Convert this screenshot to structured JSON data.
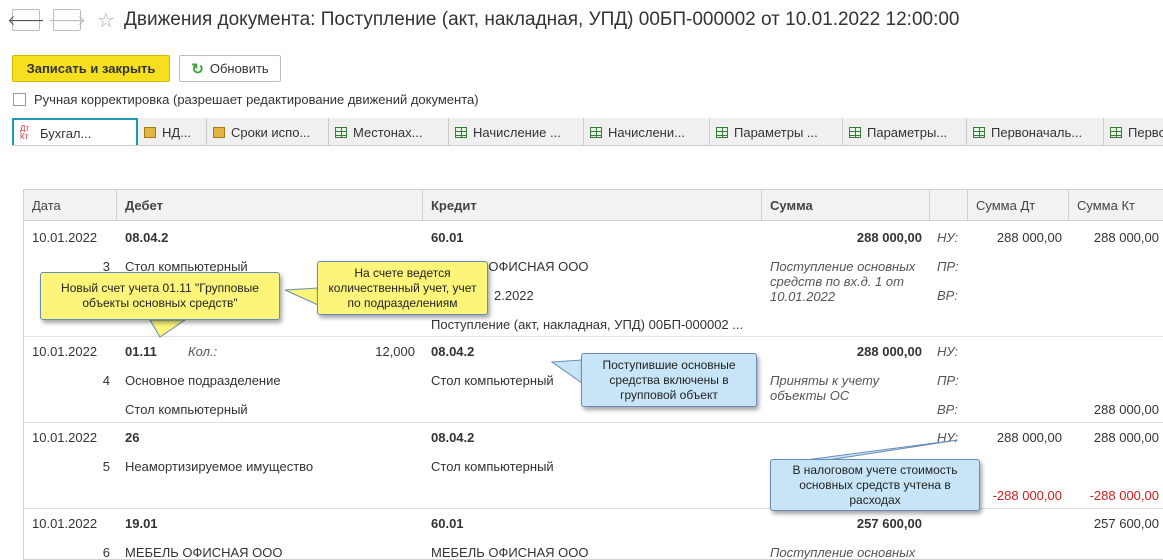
{
  "nav": {
    "back_icon": "arrow-left-icon",
    "forward_icon": "arrow-right-icon"
  },
  "window_title": "Движения документа: Поступление (акт, накладная, УПД) 00БП-000002 от 10.01.2022 12:00:00",
  "toolbar": {
    "save_close_label": "Записать и закрыть",
    "refresh_label": "Обновить"
  },
  "manual_correction_label": "Ручная корректировка (разрешает редактирование движений документа)",
  "tabs": [
    {
      "label": "Бухгал...",
      "icon": "dt-kt-icon"
    },
    {
      "label": "НД...",
      "icon": "register-icon"
    },
    {
      "label": "Сроки испо...",
      "icon": "register-icon"
    },
    {
      "label": "Местонах...",
      "icon": "table-icon"
    },
    {
      "label": "Начисление ...",
      "icon": "table-icon"
    },
    {
      "label": "Начислени...",
      "icon": "table-icon"
    },
    {
      "label": "Параметры ...",
      "icon": "table-icon"
    },
    {
      "label": "Параметры...",
      "icon": "table-icon"
    },
    {
      "label": "Первоначаль...",
      "icon": "table-icon"
    },
    {
      "label": "Первонача",
      "icon": "table-icon"
    }
  ],
  "grid": {
    "headers": {
      "date": "Дата",
      "debit": "Дебет",
      "credit": "Кредит",
      "sum": "Сумма",
      "sum_dt": "Сумма Дт",
      "sum_kt": "Сумма Кт"
    },
    "rows": [
      {
        "date": "10.01.2022",
        "num": "3",
        "debit_account": "08.04.2",
        "debit_sub1": "Стол компьютерный",
        "credit_account": "60.01",
        "credit_sub1": "МЕБЕЛЬ ОФИСНАЯ ООО",
        "credit_sub2": "2.2022",
        "credit_sub3": "Поступление (акт, накладная, УПД) 00БП-000002 ...",
        "sum": "288 000,00",
        "content": "Поступление основных средств по вх.д. 1 от 10.01.2022",
        "nu": "НУ:",
        "pr": "ПР:",
        "vr": "ВР:",
        "nu_dt": "288 000,00",
        "nu_kt": "288 000,00"
      },
      {
        "date": "10.01.2022",
        "num": "4",
        "debit_account": "01.11",
        "qty_label": "Кол.:",
        "qty": "12,000",
        "debit_sub1": "Основное подразделение",
        "debit_sub2": "Стол компьютерный",
        "credit_account": "08.04.2",
        "credit_sub1": "Стол компьютерный",
        "sum": "288 000,00",
        "content": "Приняты к учету объекты ОС",
        "nu": "НУ:",
        "pr": "ПР:",
        "vr": "ВР:",
        "vr_kt": "288 000,00"
      },
      {
        "date": "10.01.2022",
        "num": "5",
        "debit_account": "26",
        "debit_sub1": "Неамортизируемое имущество",
        "credit_account": "08.04.2",
        "credit_sub1": "Стол компьютерный",
        "nu": "НУ:",
        "nu_dt": "288 000,00",
        "nu_kt": "288 000,00",
        "vr_dt": "-288 000,00",
        "vr_kt": "-288 000,00"
      },
      {
        "date": "10.01.2022",
        "num": "6",
        "debit_account": "19.01",
        "debit_sub1": "МЕБЕЛЬ ОФИСНАЯ ООО",
        "credit_account": "60.01",
        "credit_sub1": "МЕБЕЛЬ ОФИСНАЯ ООО",
        "sum": "257 600,00",
        "content": "Поступление основных",
        "nu_kt": "257 600,00"
      }
    ]
  },
  "callouts": {
    "new_account": "Новый счет учета 01.11 \"Групповые объекты основных средств\"",
    "quantity": "На счете ведется количественный учет, учет по подразделениям",
    "group_object": "Поступившие основные средства включены в групповой объект",
    "tax": "В налоговом учете стоимость основных средств учтена в расходах"
  },
  "colors": {
    "accent": "#1c9bb5",
    "primary_button": "#f5df1e",
    "callout_yellow": "#fdf57a",
    "callout_blue": "#c7e5f7",
    "negative": "#d21c1c"
  }
}
